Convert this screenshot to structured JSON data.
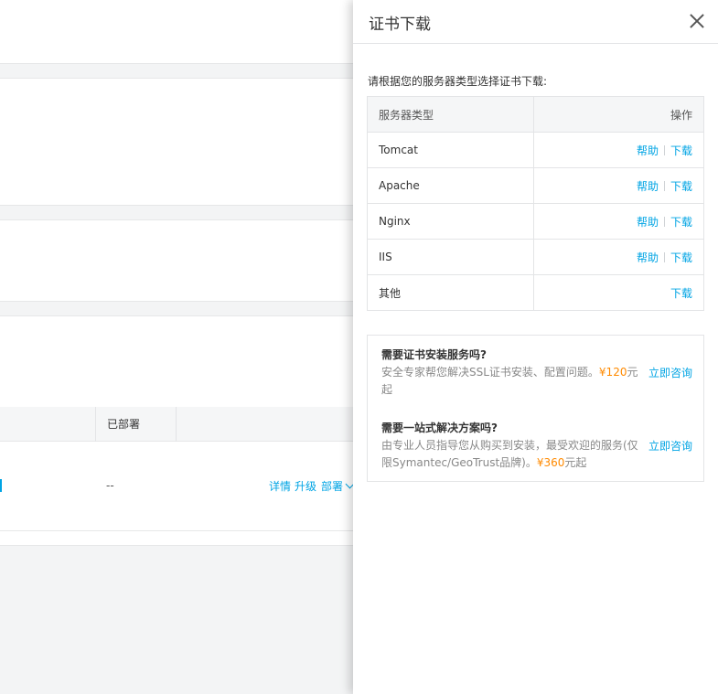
{
  "background": {
    "table_col_deployed": "已部署",
    "row_status": "--",
    "row_actions": [
      "详情",
      "升级",
      "部署"
    ]
  },
  "drawer": {
    "title": "证书下载",
    "intro": "请根据您的服务器类型选择证书下载:",
    "table": {
      "col_server_type": "服务器类型",
      "col_action": "操作",
      "help_label": "帮助",
      "download_label": "下载",
      "rows": [
        {
          "name": "Tomcat"
        },
        {
          "name": "Apache"
        },
        {
          "name": "Nginx"
        },
        {
          "name": "IIS"
        },
        {
          "name": "其他"
        }
      ]
    },
    "promo": {
      "install": {
        "title": "需要证书安装服务吗?",
        "text": "安全专家帮您解决SSL证书安装、配置问题。",
        "price": "¥120",
        "price_suffix": "元起",
        "consult": "立即咨询"
      },
      "onestop": {
        "title": "需要一站式解决方案吗?",
        "text": "由专业人员指导您从购买到安装，最受欢迎的服务(仅限Symantec/GeoTrust品牌)。",
        "price": "¥360",
        "price_suffix": "元起",
        "consult": "立即咨询"
      }
    }
  }
}
